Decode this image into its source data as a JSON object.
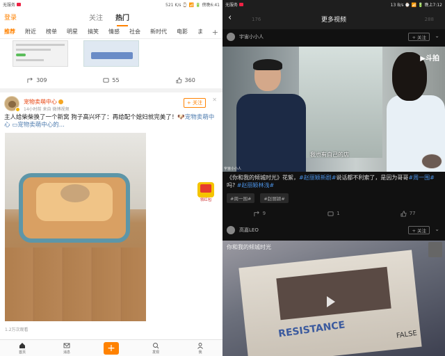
{
  "left": {
    "status": {
      "carrier": "无服务",
      "right": "521 K/s ⌚ 📶 🔋 傍晚6:41"
    },
    "header": {
      "login": "登录",
      "tabs": [
        {
          "label": "关注"
        },
        {
          "label": "热门"
        }
      ]
    },
    "nav": [
      "推荐",
      "附近",
      "榜单",
      "明星",
      "搞笑",
      "情感",
      "社会",
      "新时代",
      "电影",
      "ま"
    ],
    "nav_plus": "+",
    "prev_stats": {
      "reposts": "309",
      "comments": "55",
      "likes": "360"
    },
    "post": {
      "author": "宠物卖萌中心",
      "meta": "14小时前  来自 微博视频",
      "follow": "+ 关注",
      "text_main": "主人给柴柴换了一个新窝 狗子高兴坏了：再给配个媳妇就完美了！",
      "text_link1": "🐶宠物卖萌中心",
      "text_link2": "▭宠物卖萌中心的...",
      "views": "1.2万次观看"
    },
    "redpack": "领红包",
    "tabbar": [
      {
        "label": "首页"
      },
      {
        "label": "消息"
      },
      {
        "label": "+"
      },
      {
        "label": "发现"
      },
      {
        "label": "我"
      }
    ]
  },
  "right": {
    "status": {
      "carrier": "无服务",
      "right": "13 B/s ⌚ 📶 🔋 晚上7:12"
    },
    "header": {
      "title": "更多视频",
      "ghost_count1": "176",
      "ghost_count2": "288"
    },
    "video1": {
      "user": "宇宙小小人",
      "follow": "+ 关注",
      "subtitle": "我也有自己的店",
      "logo": "▶斗拍",
      "watermark": "宇宙小小人",
      "desc_prefix": "《你和我的倾城时光》花絮，",
      "desc_tag1": "#赵丽颖新剧#",
      "desc_mid": "说话都不利索了，是因为哥哥",
      "desc_tag2": "#周一围#",
      "desc_suffix": "吗?",
      "desc_tag3": "#赵丽颖林浅#",
      "chips": [
        "#周一围#",
        "#赵丽颖#"
      ],
      "stats": {
        "reposts": "9",
        "comments": "1",
        "likes": "77"
      }
    },
    "video2": {
      "user": "高嘉LEO",
      "follow": "+ 关注",
      "caption": "你和我的倾城时光",
      "mag_text1": "RESISTANCE",
      "mag_text2": "FALSE"
    }
  }
}
